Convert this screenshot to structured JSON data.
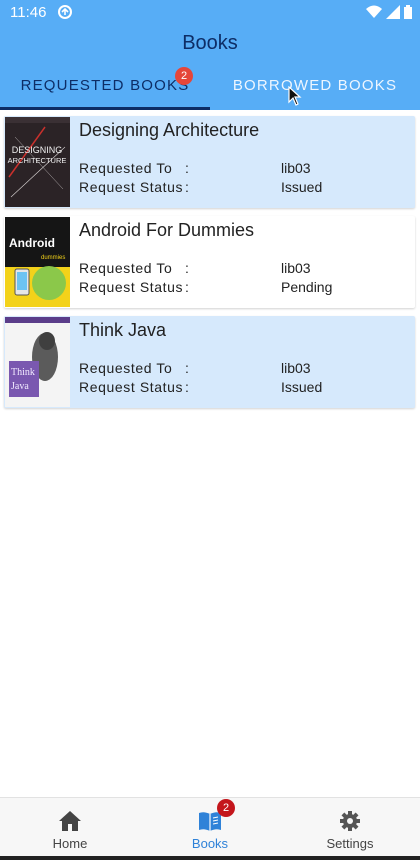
{
  "status_bar": {
    "time": "11:46"
  },
  "app_bar": {
    "title": "Books",
    "tabs": [
      {
        "label": "REQUESTED BOOKS",
        "badge": "2",
        "active": true
      },
      {
        "label": "BORROWED BOOKS",
        "active": false
      }
    ]
  },
  "books": [
    {
      "title": "Designing Architecture",
      "requested_to_label": "Requested To",
      "requested_to": "lib03",
      "status_label": "Request Status",
      "status": "Issued",
      "cover_text": "DESIGNING ARCHITECTURE",
      "highlighted": true
    },
    {
      "title": "Android For Dummies",
      "requested_to_label": "Requested To",
      "requested_to": "lib03",
      "status_label": "Request Status",
      "status": "Pending",
      "cover_text": "Android",
      "cover_subtext": "dummies",
      "highlighted": false
    },
    {
      "title": "Think Java",
      "requested_to_label": "Requested To",
      "requested_to": "lib03",
      "status_label": "Request Status",
      "status": "Issued",
      "cover_text": "Think Java",
      "highlighted": true
    }
  ],
  "bottom_nav": {
    "items": [
      {
        "label": "Home",
        "icon": "home-icon"
      },
      {
        "label": "Books",
        "icon": "book-icon",
        "badge": "2",
        "active": true
      },
      {
        "label": "Settings",
        "icon": "gear-icon"
      }
    ]
  },
  "colors": {
    "app_bar": "#57adf6",
    "title_text": "#0d2d66",
    "card_highlight": "#d6e9fc",
    "active_nav": "#2f82d8",
    "badge": "#e5463a"
  }
}
